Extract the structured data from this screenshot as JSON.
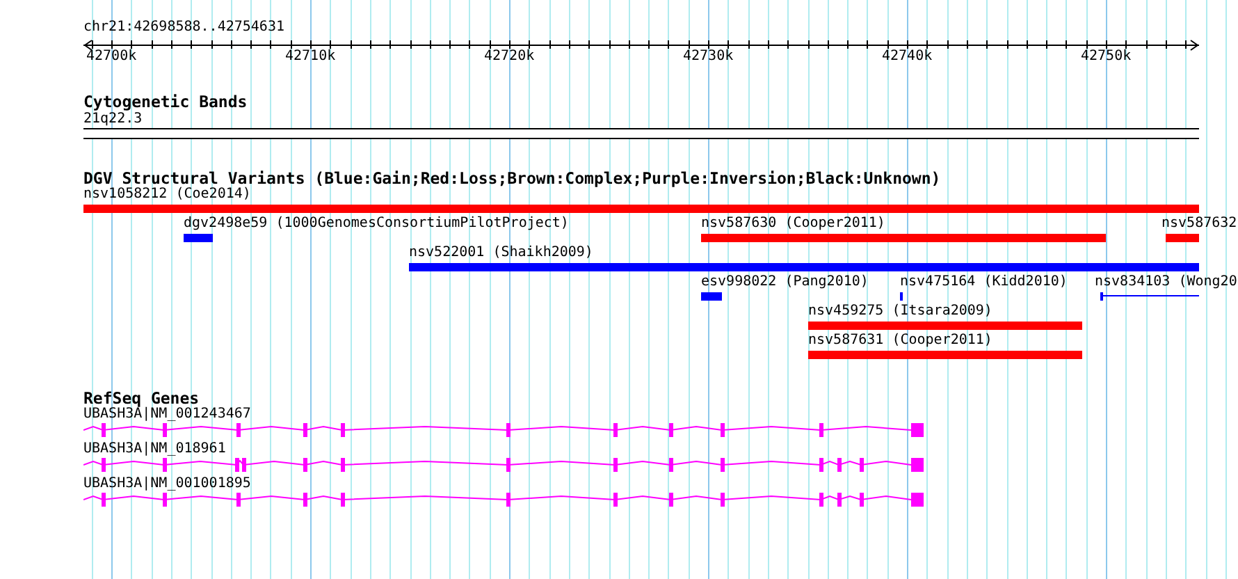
{
  "ruler": {
    "location": "chr21:42698588..42754631",
    "ticks": [
      "42700k",
      "42710k",
      "42720k",
      "42730k",
      "42740k",
      "42750k"
    ]
  },
  "tracks": [
    {
      "kind": "bands",
      "title": "Cytogenetic Bands",
      "features": [
        {
          "label": "21q22.3"
        }
      ]
    },
    {
      "kind": "variants",
      "title": "DGV Structural Variants (Blue:Gain;Red:Loss;Brown:Complex;Purple:Inversion;Black:Unknown)",
      "features": [
        {
          "label": "nsv1058212 (Coe2014)",
          "color": "#ff0000",
          "kind": "bar"
        },
        {
          "label": "dgv2498e59 (1000GenomesConsortiumPilotProject)",
          "color": "#0000ff",
          "kind": "bar"
        },
        {
          "label": "nsv587630 (Cooper2011)",
          "color": "#ff0000",
          "kind": "bar"
        },
        {
          "label": "nsv587632",
          "color": "#ff0000",
          "kind": "bar"
        },
        {
          "label": "nsv522001 (Shaikh2009)",
          "color": "#0000ff",
          "kind": "bar"
        },
        {
          "label": "esv998022 (Pang2010)",
          "color": "#0000ff",
          "kind": "bar"
        },
        {
          "label": "nsv475164 (Kidd2010)",
          "color": "#0000ff",
          "kind": "bar"
        },
        {
          "label": "nsv834103 (Wong20",
          "color": "#0000ff",
          "kind": "line"
        },
        {
          "label": "nsv459275 (Itsara2009)",
          "color": "#ff0000",
          "kind": "bar"
        },
        {
          "label": "nsv587631 (Cooper2011)",
          "color": "#ff0000",
          "kind": "bar"
        }
      ]
    },
    {
      "kind": "genes",
      "title": "RefSeq Genes",
      "features": [
        {
          "label": "UBASH3A|NM_001243467"
        },
        {
          "label": "UBASH3A|NM_018961"
        },
        {
          "label": "UBASH3A|NM_001001895"
        }
      ]
    }
  ]
}
